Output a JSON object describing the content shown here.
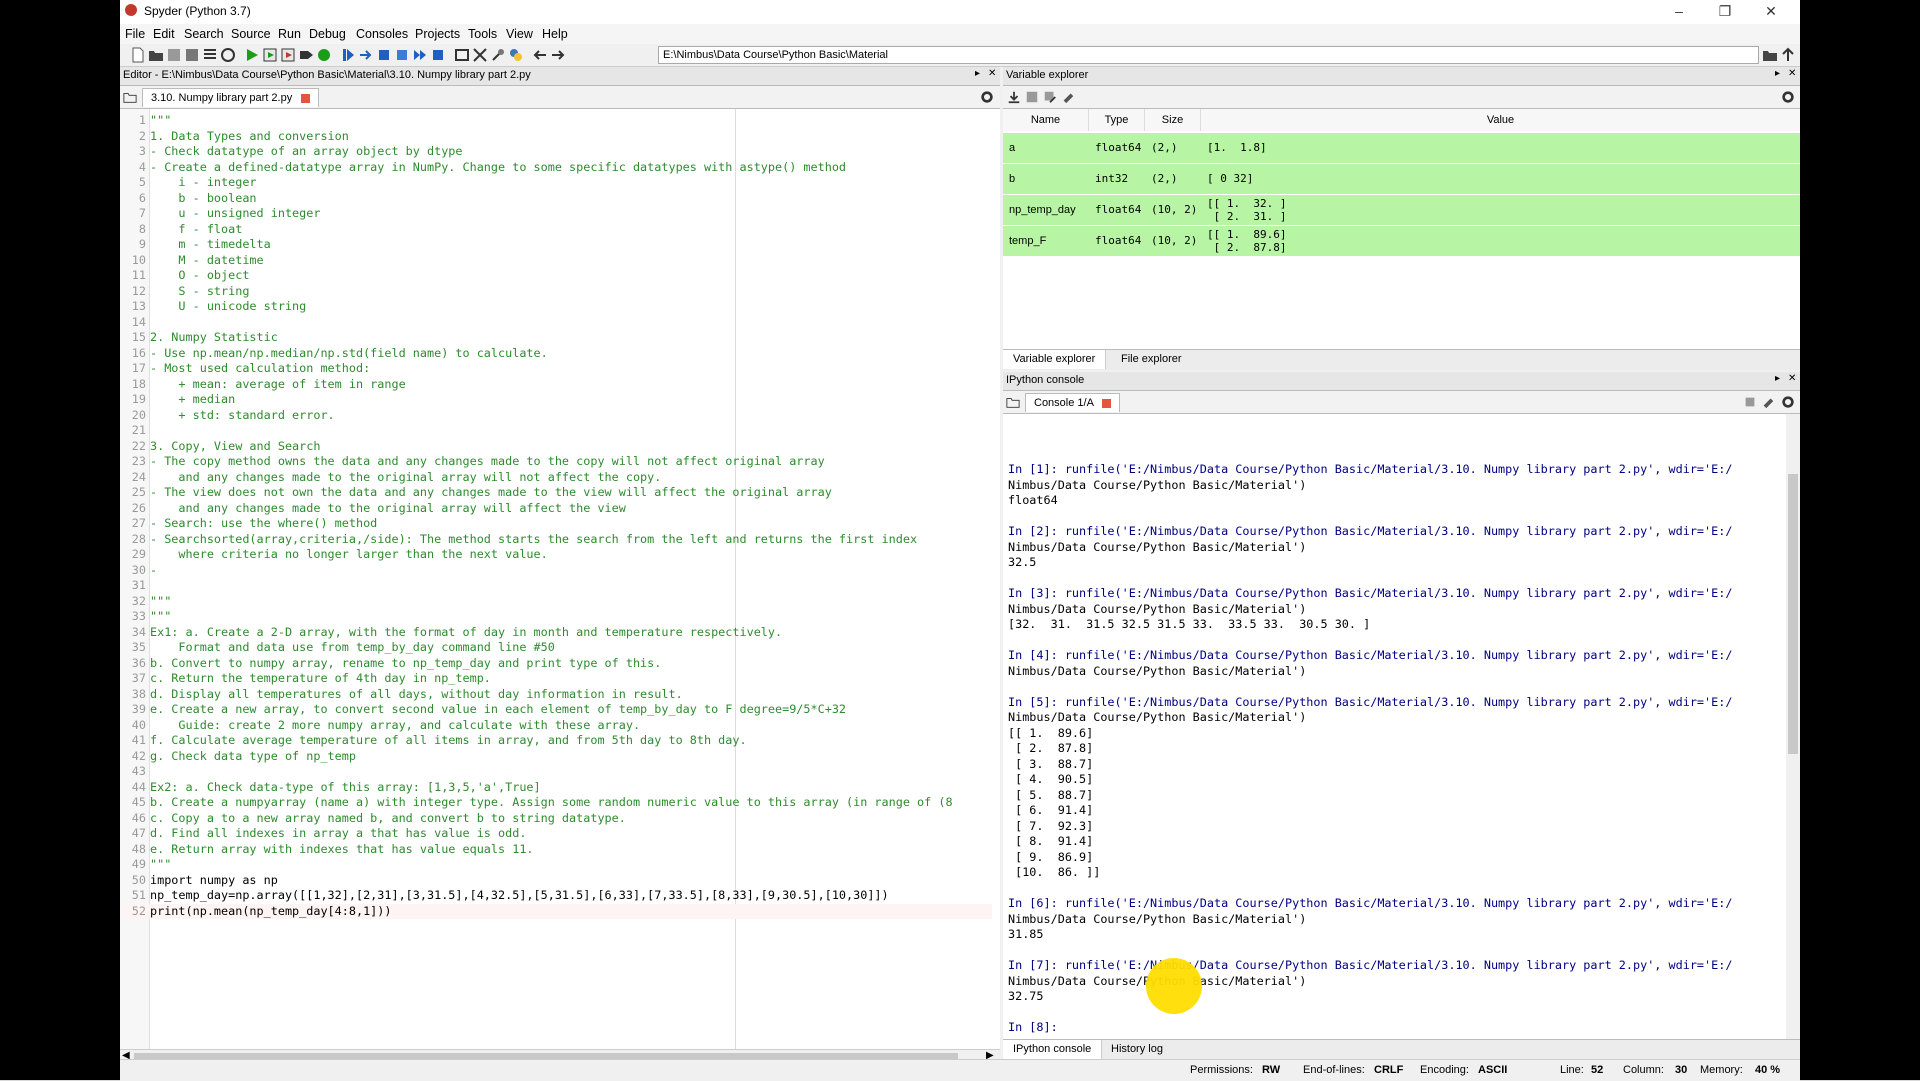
{
  "window": {
    "title": "Spyder (Python 3.7)"
  },
  "menu": [
    "File",
    "Edit",
    "Search",
    "Source",
    "Run",
    "Debug",
    "Consoles",
    "Projects",
    "Tools",
    "View",
    "Help"
  ],
  "toolbar": {
    "path": "E:\\Nimbus\\Data Course\\Python Basic\\Material"
  },
  "editor": {
    "header": "Editor - E:\\Nimbus\\Data Course\\Python Basic\\Material\\3.10. Numpy library part 2.py",
    "tab": "3.10. Numpy library part 2.py",
    "current_line": 52,
    "lines": [
      "\"\"\"",
      "1. Data Types and conversion",
      "- Check datatype of an array object by dtype",
      "- Create a defined-datatype array in NumPy. Change to some specific datatypes with astype() method",
      "    i - integer",
      "    b - boolean",
      "    u - unsigned integer",
      "    f - float",
      "    m - timedelta",
      "    M - datetime",
      "    O - object",
      "    S - string",
      "    U - unicode string",
      "",
      "2. Numpy Statistic",
      "- Use np.mean/np.median/np.std(field name) to calculate.",
      "- Most used calculation method:",
      "    + mean: average of item in range",
      "    + median",
      "    + std: standard error.",
      "",
      "3. Copy, View and Search",
      "- The copy method owns the data and any changes made to the copy will not affect original array",
      "    and any changes made to the original array will not affect the copy.",
      "- The view does not own the data and any changes made to the view will affect the original array",
      "    and any changes made to the original array will affect the view",
      "- Search: use the where() method",
      "- Searchsorted(array,criteria,/side): The method starts the search from the left and returns the first index",
      "    where criteria no longer larger than the next value.",
      "-",
      "",
      "\"\"\"",
      "\"\"\"",
      "Ex1: a. Create a 2-D array, with the format of day in month and temperature respectively.",
      "    Format and data use from temp_by_day command line #50",
      "b. Convert to numpy array, rename to np_temp_day and print type of this.",
      "c. Return the temperature of 4th day in np_temp.",
      "d. Display all temperatures of all days, without day information in result.",
      "e. Create a new array, to convert second value in each element of temp_by_day to F degree=9/5*C+32",
      "    Guide: create 2 more numpy array, and calculate with these array.",
      "f. Calculate average temperature of all items in array, and from 5th day to 8th day.",
      "g. Check data type of np_temp",
      "",
      "Ex2: a. Check data-type of this array: [1,3,5,'a',True]",
      "b. Create a numpyarray (name a) with integer type. Assign some random numeric value to this array (in range of (8",
      "c. Copy a to a new array named b, and convert b to string datatype.",
      "d. Find all indexes in array a that has value is odd.",
      "e. Return array with indexes that has value equals 11.",
      "\"\"\"",
      "import numpy as np",
      "np_temp_day=np.array([[1,32],[2,31],[3,31.5],[4,32.5],[5,31.5],[6,33],[7,33.5],[8,33],[9,30.5],[10,30]])",
      "print(np.mean(np_temp_day[4:8,1]))"
    ]
  },
  "variable_explorer": {
    "title": "Variable explorer",
    "columns": [
      "Name",
      "Type",
      "Size",
      "Value"
    ],
    "rows": [
      {
        "name": "a",
        "type": "float64",
        "size": "(2,)",
        "value": "[1.  1.8]"
      },
      {
        "name": "b",
        "type": "int32",
        "size": "(2,)",
        "value": "[ 0 32]"
      },
      {
        "name": "np_temp_day",
        "type": "float64",
        "size": "(10, 2)",
        "value": "[[ 1.  32. ]\n [ 2.  31. ]"
      },
      {
        "name": "temp_F",
        "type": "float64",
        "size": "(10, 2)",
        "value": "[[ 1.  89.6]\n [ 2.  87.8]"
      }
    ],
    "tabs": [
      "Variable explorer",
      "File explorer"
    ]
  },
  "console": {
    "title": "IPython console",
    "tab": "Console 1/A",
    "lines": [
      "In [1]: runfile('E:/Nimbus/Data Course/Python Basic/Material/3.10. Numpy library part 2.py', wdir='E:/",
      "Nimbus/Data Course/Python Basic/Material')",
      "float64",
      "",
      "In [2]: runfile('E:/Nimbus/Data Course/Python Basic/Material/3.10. Numpy library part 2.py', wdir='E:/",
      "Nimbus/Data Course/Python Basic/Material')",
      "32.5",
      "",
      "In [3]: runfile('E:/Nimbus/Data Course/Python Basic/Material/3.10. Numpy library part 2.py', wdir='E:/",
      "Nimbus/Data Course/Python Basic/Material')",
      "[32.  31.  31.5 32.5 31.5 33.  33.5 33.  30.5 30. ]",
      "",
      "In [4]: runfile('E:/Nimbus/Data Course/Python Basic/Material/3.10. Numpy library part 2.py', wdir='E:/",
      "Nimbus/Data Course/Python Basic/Material')",
      "",
      "In [5]: runfile('E:/Nimbus/Data Course/Python Basic/Material/3.10. Numpy library part 2.py', wdir='E:/",
      "Nimbus/Data Course/Python Basic/Material')",
      "[[ 1.  89.6]",
      " [ 2.  87.8]",
      " [ 3.  88.7]",
      " [ 4.  90.5]",
      " [ 5.  88.7]",
      " [ 6.  91.4]",
      " [ 7.  92.3]",
      " [ 8.  91.4]",
      " [ 9.  86.9]",
      " [10.  86. ]]",
      "",
      "In [6]: runfile('E:/Nimbus/Data Course/Python Basic/Material/3.10. Numpy library part 2.py', wdir='E:/",
      "Nimbus/Data Course/Python Basic/Material')",
      "31.85",
      "",
      "In [7]: runfile('E:/Nimbus/Data Course/Python Basic/Material/3.10. Numpy library part 2.py', wdir='E:/",
      "Nimbus/Data Course/Python Basic/Material')",
      "32.75",
      "",
      "In [8]:"
    ],
    "tabs": [
      "IPython console",
      "History log"
    ]
  },
  "status": {
    "permissions_label": "Permissions:",
    "permissions": "RW",
    "eol_label": "End-of-lines:",
    "eol": "CRLF",
    "encoding_label": "Encoding:",
    "encoding": "ASCII",
    "line_label": "Line:",
    "line": "52",
    "column_label": "Column:",
    "column": "30",
    "memory_label": "Memory:",
    "memory": "40 %"
  }
}
